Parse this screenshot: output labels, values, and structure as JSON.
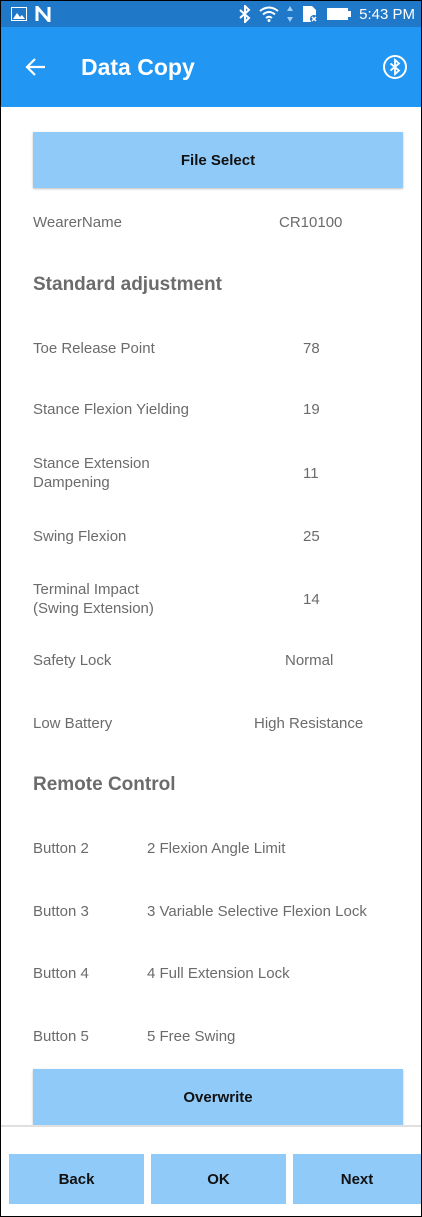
{
  "status_bar": {
    "time": "5:43 PM",
    "icons": [
      "image-icon",
      "n-notification-icon",
      "bluetooth-icon",
      "wifi-icon",
      "data-transfer-icon",
      "sim-icon",
      "battery-icon"
    ]
  },
  "app_bar": {
    "title": "Data Copy",
    "back_icon": "arrow-left-icon",
    "bluetooth_icon": "bluetooth-icon"
  },
  "file_select_label": "File Select",
  "wearer": {
    "label": "WearerName",
    "value": "CR10100"
  },
  "standard_adjustment": {
    "heading": "Standard adjustment",
    "rows": [
      {
        "label": "Toe Release Point",
        "value": "78"
      },
      {
        "label": "Stance Flexion Yielding",
        "value": "19"
      },
      {
        "label_line1": "Stance Extension",
        "label_line2": "Dampening",
        "value": "11"
      },
      {
        "label": "Swing Flexion",
        "value": "25"
      },
      {
        "label_line1": "Terminal Impact",
        "label_line2": "(Swing Extension)",
        "value": "14"
      },
      {
        "label": "Safety Lock",
        "value": "Normal"
      },
      {
        "label": "Low Battery",
        "value": "High Resistance"
      }
    ]
  },
  "remote_control": {
    "heading": "Remote Control",
    "rows": [
      {
        "label": "Button 2",
        "value": "2 Flexion Angle Limit"
      },
      {
        "label": "Button 3",
        "value": "3 Variable Selective Flexion Lock"
      },
      {
        "label": "Button 4",
        "value": "4 Full Extension Lock"
      },
      {
        "label": "Button 5",
        "value": "5 Free Swing"
      }
    ]
  },
  "overwrite_label": "Overwrite",
  "bottom_nav": {
    "back": "Back",
    "ok": "OK",
    "next": "Next"
  },
  "colors": {
    "status_bar": "#1f78c8",
    "app_bar": "#2196f3",
    "button": "#90caf9",
    "text": "#6b6b6b"
  }
}
